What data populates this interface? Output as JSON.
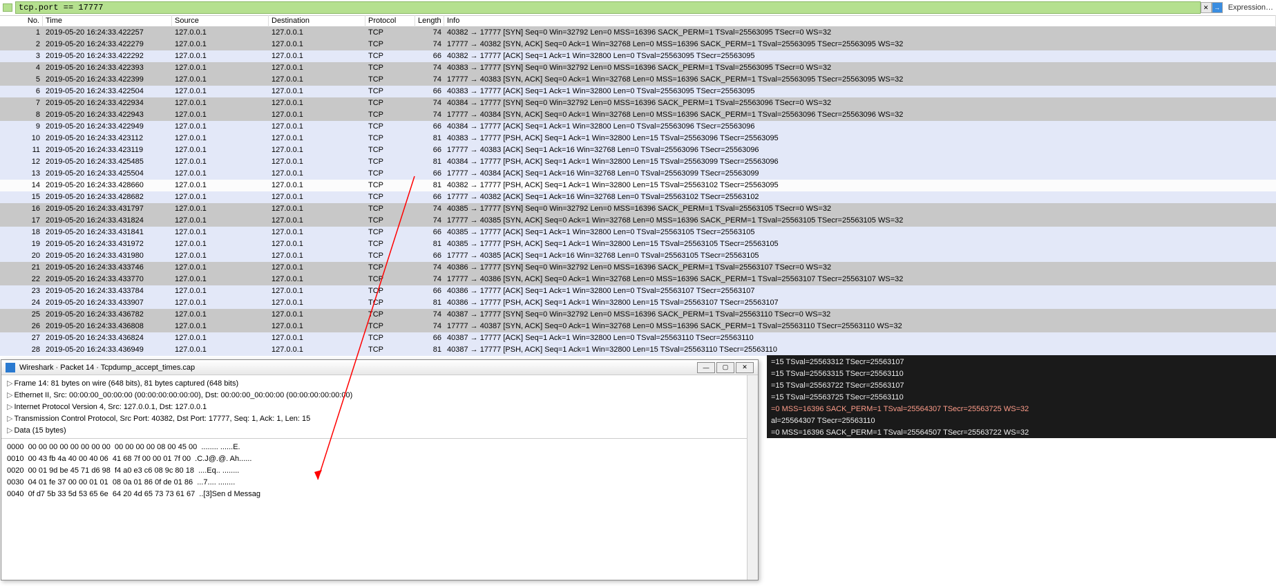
{
  "filter": {
    "value": "tcp.port == 17777",
    "clear": "✕",
    "apply": "→",
    "expr": "Expression…"
  },
  "columns": [
    "No.",
    "Time",
    "Source",
    "Destination",
    "Protocol",
    "Length",
    "Info"
  ],
  "packets": [
    {
      "no": "1",
      "time": "2019-05-20 16:24:33.422257",
      "src": "127.0.0.1",
      "dst": "127.0.0.1",
      "proto": "TCP",
      "len": "74",
      "info": "40382 → 17777 [SYN] Seq=0 Win=32792 Len=0 MSS=16396 SACK_PERM=1 TSval=25563095 TSecr=0 WS=32",
      "cls": "syn"
    },
    {
      "no": "2",
      "time": "2019-05-20 16:24:33.422279",
      "src": "127.0.0.1",
      "dst": "127.0.0.1",
      "proto": "TCP",
      "len": "74",
      "info": "17777 → 40382 [SYN, ACK] Seq=0 Ack=1 Win=32768 Len=0 MSS=16396 SACK_PERM=1 TSval=25563095 TSecr=25563095 WS=32",
      "cls": "syn"
    },
    {
      "no": "3",
      "time": "2019-05-20 16:24:33.422292",
      "src": "127.0.0.1",
      "dst": "127.0.0.1",
      "proto": "TCP",
      "len": "66",
      "info": "40382 → 17777 [ACK] Seq=1 Ack=1 Win=32800 Len=0 TSval=25563095 TSecr=25563095",
      "cls": "plain"
    },
    {
      "no": "4",
      "time": "2019-05-20 16:24:33.422393",
      "src": "127.0.0.1",
      "dst": "127.0.0.1",
      "proto": "TCP",
      "len": "74",
      "info": "40383 → 17777 [SYN] Seq=0 Win=32792 Len=0 MSS=16396 SACK_PERM=1 TSval=25563095 TSecr=0 WS=32",
      "cls": "syn"
    },
    {
      "no": "5",
      "time": "2019-05-20 16:24:33.422399",
      "src": "127.0.0.1",
      "dst": "127.0.0.1",
      "proto": "TCP",
      "len": "74",
      "info": "17777 → 40383 [SYN, ACK] Seq=0 Ack=1 Win=32768 Len=0 MSS=16396 SACK_PERM=1 TSval=25563095 TSecr=25563095 WS=32",
      "cls": "syn"
    },
    {
      "no": "6",
      "time": "2019-05-20 16:24:33.422504",
      "src": "127.0.0.1",
      "dst": "127.0.0.1",
      "proto": "TCP",
      "len": "66",
      "info": "40383 → 17777 [ACK] Seq=1 Ack=1 Win=32800 Len=0 TSval=25563095 TSecr=25563095",
      "cls": "plain"
    },
    {
      "no": "7",
      "time": "2019-05-20 16:24:33.422934",
      "src": "127.0.0.1",
      "dst": "127.0.0.1",
      "proto": "TCP",
      "len": "74",
      "info": "40384 → 17777 [SYN] Seq=0 Win=32792 Len=0 MSS=16396 SACK_PERM=1 TSval=25563096 TSecr=0 WS=32",
      "cls": "syn"
    },
    {
      "no": "8",
      "time": "2019-05-20 16:24:33.422943",
      "src": "127.0.0.1",
      "dst": "127.0.0.1",
      "proto": "TCP",
      "len": "74",
      "info": "17777 → 40384 [SYN, ACK] Seq=0 Ack=1 Win=32768 Len=0 MSS=16396 SACK_PERM=1 TSval=25563096 TSecr=25563096 WS=32",
      "cls": "syn"
    },
    {
      "no": "9",
      "time": "2019-05-20 16:24:33.422949",
      "src": "127.0.0.1",
      "dst": "127.0.0.1",
      "proto": "TCP",
      "len": "66",
      "info": "40384 → 17777 [ACK] Seq=1 Ack=1 Win=32800 Len=0 TSval=25563096 TSecr=25563096",
      "cls": "plain"
    },
    {
      "no": "10",
      "time": "2019-05-20 16:24:33.423112",
      "src": "127.0.0.1",
      "dst": "127.0.0.1",
      "proto": "TCP",
      "len": "81",
      "info": "40383 → 17777 [PSH, ACK] Seq=1 Ack=1 Win=32800 Len=15 TSval=25563096 TSecr=25563095",
      "cls": "plain"
    },
    {
      "no": "11",
      "time": "2019-05-20 16:24:33.423119",
      "src": "127.0.0.1",
      "dst": "127.0.0.1",
      "proto": "TCP",
      "len": "66",
      "info": "17777 → 40383 [ACK] Seq=1 Ack=16 Win=32768 Len=0 TSval=25563096 TSecr=25563096",
      "cls": "plain"
    },
    {
      "no": "12",
      "time": "2019-05-20 16:24:33.425485",
      "src": "127.0.0.1",
      "dst": "127.0.0.1",
      "proto": "TCP",
      "len": "81",
      "info": "40384 → 17777 [PSH, ACK] Seq=1 Ack=1 Win=32800 Len=15 TSval=25563099 TSecr=25563096",
      "cls": "plain"
    },
    {
      "no": "13",
      "time": "2019-05-20 16:24:33.425504",
      "src": "127.0.0.1",
      "dst": "127.0.0.1",
      "proto": "TCP",
      "len": "66",
      "info": "17777 → 40384 [ACK] Seq=1 Ack=16 Win=32768 Len=0 TSval=25563099 TSecr=25563099",
      "cls": "plain"
    },
    {
      "no": "14",
      "time": "2019-05-20 16:24:33.428660",
      "src": "127.0.0.1",
      "dst": "127.0.0.1",
      "proto": "TCP",
      "len": "81",
      "info": "40382 → 17777 [PSH, ACK] Seq=1 Ack=1 Win=32800 Len=15 TSval=25563102 TSecr=25563095",
      "cls": "sel-high"
    },
    {
      "no": "15",
      "time": "2019-05-20 16:24:33.428682",
      "src": "127.0.0.1",
      "dst": "127.0.0.1",
      "proto": "TCP",
      "len": "66",
      "info": "17777 → 40382 [ACK] Seq=1 Ack=16 Win=32768 Len=0 TSval=25563102 TSecr=25563102",
      "cls": "plain"
    },
    {
      "no": "16",
      "time": "2019-05-20 16:24:33.431797",
      "src": "127.0.0.1",
      "dst": "127.0.0.1",
      "proto": "TCP",
      "len": "74",
      "info": "40385 → 17777 [SYN] Seq=0 Win=32792 Len=0 MSS=16396 SACK_PERM=1 TSval=25563105 TSecr=0 WS=32",
      "cls": "syn"
    },
    {
      "no": "17",
      "time": "2019-05-20 16:24:33.431824",
      "src": "127.0.0.1",
      "dst": "127.0.0.1",
      "proto": "TCP",
      "len": "74",
      "info": "17777 → 40385 [SYN, ACK] Seq=0 Ack=1 Win=32768 Len=0 MSS=16396 SACK_PERM=1 TSval=25563105 TSecr=25563105 WS=32",
      "cls": "syn"
    },
    {
      "no": "18",
      "time": "2019-05-20 16:24:33.431841",
      "src": "127.0.0.1",
      "dst": "127.0.0.1",
      "proto": "TCP",
      "len": "66",
      "info": "40385 → 17777 [ACK] Seq=1 Ack=1 Win=32800 Len=0 TSval=25563105 TSecr=25563105",
      "cls": "plain"
    },
    {
      "no": "19",
      "time": "2019-05-20 16:24:33.431972",
      "src": "127.0.0.1",
      "dst": "127.0.0.1",
      "proto": "TCP",
      "len": "81",
      "info": "40385 → 17777 [PSH, ACK] Seq=1 Ack=1 Win=32800 Len=15 TSval=25563105 TSecr=25563105",
      "cls": "plain"
    },
    {
      "no": "20",
      "time": "2019-05-20 16:24:33.431980",
      "src": "127.0.0.1",
      "dst": "127.0.0.1",
      "proto": "TCP",
      "len": "66",
      "info": "17777 → 40385 [ACK] Seq=1 Ack=16 Win=32768 Len=0 TSval=25563105 TSecr=25563105",
      "cls": "plain"
    },
    {
      "no": "21",
      "time": "2019-05-20 16:24:33.433746",
      "src": "127.0.0.1",
      "dst": "127.0.0.1",
      "proto": "TCP",
      "len": "74",
      "info": "40386 → 17777 [SYN] Seq=0 Win=32792 Len=0 MSS=16396 SACK_PERM=1 TSval=25563107 TSecr=0 WS=32",
      "cls": "syn"
    },
    {
      "no": "22",
      "time": "2019-05-20 16:24:33.433770",
      "src": "127.0.0.1",
      "dst": "127.0.0.1",
      "proto": "TCP",
      "len": "74",
      "info": "17777 → 40386 [SYN, ACK] Seq=0 Ack=1 Win=32768 Len=0 MSS=16396 SACK_PERM=1 TSval=25563107 TSecr=25563107 WS=32",
      "cls": "syn"
    },
    {
      "no": "23",
      "time": "2019-05-20 16:24:33.433784",
      "src": "127.0.0.1",
      "dst": "127.0.0.1",
      "proto": "TCP",
      "len": "66",
      "info": "40386 → 17777 [ACK] Seq=1 Ack=1 Win=32800 Len=0 TSval=25563107 TSecr=25563107",
      "cls": "plain"
    },
    {
      "no": "24",
      "time": "2019-05-20 16:24:33.433907",
      "src": "127.0.0.1",
      "dst": "127.0.0.1",
      "proto": "TCP",
      "len": "81",
      "info": "40386 → 17777 [PSH, ACK] Seq=1 Ack=1 Win=32800 Len=15 TSval=25563107 TSecr=25563107",
      "cls": "plain"
    },
    {
      "no": "25",
      "time": "2019-05-20 16:24:33.436782",
      "src": "127.0.0.1",
      "dst": "127.0.0.1",
      "proto": "TCP",
      "len": "74",
      "info": "40387 → 17777 [SYN] Seq=0 Win=32792 Len=0 MSS=16396 SACK_PERM=1 TSval=25563110 TSecr=0 WS=32",
      "cls": "syn"
    },
    {
      "no": "26",
      "time": "2019-05-20 16:24:33.436808",
      "src": "127.0.0.1",
      "dst": "127.0.0.1",
      "proto": "TCP",
      "len": "74",
      "info": "17777 → 40387 [SYN, ACK] Seq=0 Ack=1 Win=32768 Len=0 MSS=16396 SACK_PERM=1 TSval=25563110 TSecr=25563110 WS=32",
      "cls": "syn"
    },
    {
      "no": "27",
      "time": "2019-05-20 16:24:33.436824",
      "src": "127.0.0.1",
      "dst": "127.0.0.1",
      "proto": "TCP",
      "len": "66",
      "info": "40387 → 17777 [ACK] Seq=1 Ack=1 Win=32800 Len=0 TSval=25563110 TSecr=25563110",
      "cls": "plain"
    },
    {
      "no": "28",
      "time": "2019-05-20 16:24:33.436949",
      "src": "127.0.0.1",
      "dst": "127.0.0.1",
      "proto": "TCP",
      "len": "81",
      "info": "40387 → 17777 [PSH, ACK] Seq=1 Ack=1 Win=32800 Len=15 TSval=25563110 TSecr=25563110",
      "cls": "plain"
    }
  ],
  "dark_rows": [
    {
      "txt": "=15 TSval=25563312 TSecr=25563107",
      "hl": false
    },
    {
      "txt": "=15 TSval=25563315 TSecr=25563110",
      "hl": false
    },
    {
      "txt": "=15 TSval=25563722 TSecr=25563107",
      "hl": false
    },
    {
      "txt": "=15 TSval=25563725 TSecr=25563110",
      "hl": false
    },
    {
      "txt": "=0 MSS=16396 SACK_PERM=1 TSval=25564307 TSecr=25563725 WS=32",
      "hl": true
    },
    {
      "txt": "al=25564307 TSecr=25563110",
      "hl": false
    },
    {
      "txt": "=0 MSS=16396 SACK_PERM=1 TSval=25564507 TSecr=25563722 WS=32",
      "hl": false
    }
  ],
  "detail": {
    "title": "Wireshark · Packet 14 · Tcpdump_accept_times.cap",
    "tree": [
      "Frame 14: 81 bytes on wire (648 bits), 81 bytes captured (648 bits)",
      "Ethernet II, Src: 00:00:00_00:00:00 (00:00:00:00:00:00), Dst: 00:00:00_00:00:00 (00:00:00:00:00:00)",
      "Internet Protocol Version 4, Src: 127.0.0.1, Dst: 127.0.0.1",
      "Transmission Control Protocol, Src Port: 40382, Dst Port: 17777, Seq: 1, Ack: 1, Len: 15",
      "Data (15 bytes)"
    ],
    "hex": [
      {
        "off": "0000",
        "b": "00 00 00 00 00 00 00 00  00 00 00 00 08 00 45 00",
        "a": "  ........ ......E."
      },
      {
        "off": "0010",
        "b": "00 43 fb 4a 40 00 40 06  41 68 7f 00 00 01 7f 00",
        "a": "  .C.J@.@. Ah......"
      },
      {
        "off": "0020",
        "b": "00 01 9d be 45 71 d6 98  f4 a0 e3 c6 08 9c 80 18",
        "a": "  ....Eq.. ........"
      },
      {
        "off": "0030",
        "b": "04 01 fe 37 00 00 01 01  08 0a 01 86 0f de 01 86",
        "a": "  ...7.... ........"
      },
      {
        "off": "0040",
        "b": "0f d7 5b 33 5d 53 65 6e  64 20 4d 65 73 73 61 67",
        "a": "  ..[3]Sen d Messag"
      }
    ],
    "winbtns": {
      "min": "—",
      "max": "▢",
      "close": "✕"
    }
  }
}
